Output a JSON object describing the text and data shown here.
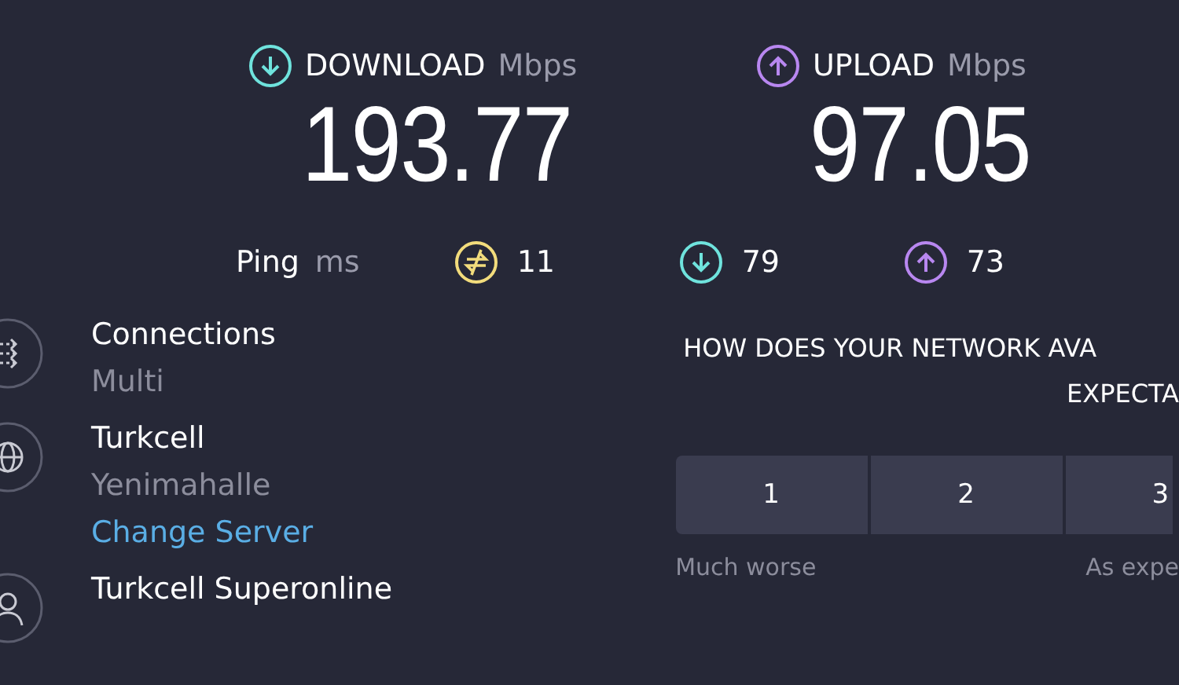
{
  "results": [
    {
      "kind": "download",
      "label": "DOWNLOAD",
      "unit": "Mbps",
      "value": "193.77"
    },
    {
      "kind": "upload",
      "label": "UPLOAD",
      "unit": "Mbps",
      "value": "97.05"
    }
  ],
  "ping": {
    "label": "Ping",
    "unit": "ms",
    "readings": [
      {
        "kind": "ping",
        "value": "11"
      },
      {
        "kind": "download",
        "value": "79"
      },
      {
        "kind": "upload",
        "value": "73"
      }
    ]
  },
  "info": [
    {
      "kind": "connections",
      "title": "Connections",
      "subtitle": "Multi"
    },
    {
      "kind": "server",
      "title": "Turkcell",
      "subtitle": "Yenimahalle",
      "link": "Change Server"
    },
    {
      "kind": "provider",
      "title": "Turkcell Superonline"
    }
  ],
  "survey": {
    "question_lines": [
      "HOW DOES YOUR NETWORK AVA",
      "EXPECTA"
    ],
    "options": [
      "1",
      "2",
      "3"
    ],
    "scale_labels": [
      "Much worse",
      "As expe"
    ]
  }
}
